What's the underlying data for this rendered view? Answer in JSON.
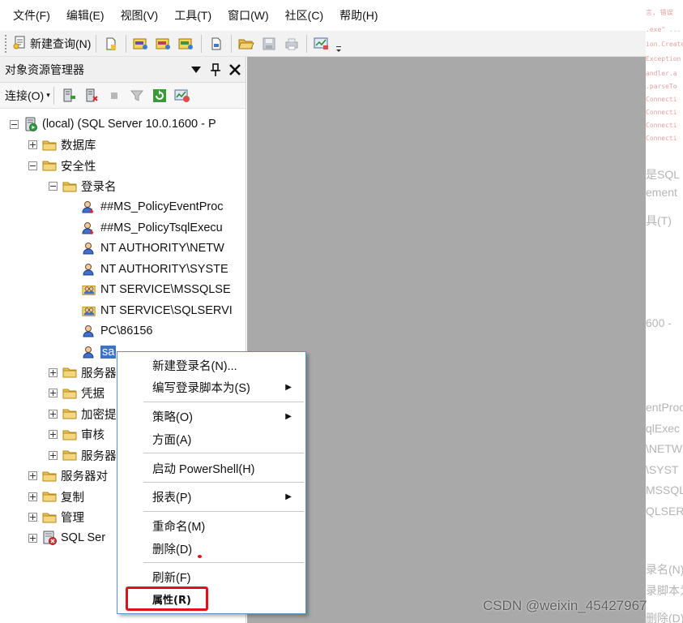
{
  "menubar": [
    "文件(F)",
    "编辑(E)",
    "视图(V)",
    "工具(T)",
    "窗口(W)",
    "社区(C)",
    "帮助(H)"
  ],
  "toolbar": {
    "new_query": "新建查询(N)"
  },
  "panel": {
    "title": "对象资源管理器",
    "pin": "ꟸ",
    "connect": "连接(O)",
    "connect_caret": "▾"
  },
  "tree": [
    {
      "label": "(local) (SQL Server 10.0.1600 - P",
      "level": 0,
      "expander": "⊟",
      "icon": "server-icon",
      "name": "tree-server-root"
    },
    {
      "label": "数据库",
      "level": 1,
      "expander": "⊞",
      "icon": "folder-icon",
      "name": "tree-databases"
    },
    {
      "label": "安全性",
      "level": 1,
      "expander": "⊟",
      "icon": "folder-icon",
      "name": "tree-security"
    },
    {
      "label": "登录名",
      "level": 2,
      "expander": "⊟",
      "icon": "folder-icon",
      "name": "tree-logins"
    },
    {
      "label": "##MS_PolicyEventProc",
      "level": 3,
      "expander": "",
      "icon": "login-disabled-icon",
      "name": "tree-login"
    },
    {
      "label": "##MS_PolicyTsqlExecu",
      "level": 3,
      "expander": "",
      "icon": "login-disabled-icon",
      "name": "tree-login"
    },
    {
      "label": "NT AUTHORITY\\NETW",
      "level": 3,
      "expander": "",
      "icon": "login-icon",
      "name": "tree-login"
    },
    {
      "label": "NT AUTHORITY\\SYSTE",
      "level": 3,
      "expander": "",
      "icon": "login-icon",
      "name": "tree-login"
    },
    {
      "label": "NT SERVICE\\MSSQLSE",
      "level": 3,
      "expander": "",
      "icon": "group-login-icon",
      "name": "tree-login"
    },
    {
      "label": "NT SERVICE\\SQLSERVI",
      "level": 3,
      "expander": "",
      "icon": "group-login-icon",
      "name": "tree-login"
    },
    {
      "label": "PC\\86156",
      "level": 3,
      "expander": "",
      "icon": "login-icon",
      "name": "tree-login"
    },
    {
      "label": "sa",
      "level": 3,
      "expander": "",
      "icon": "login-icon",
      "name": "tree-login-sa",
      "selected": true
    },
    {
      "label": "服务器",
      "level": 2,
      "expander": "⊞",
      "icon": "folder-icon",
      "name": "tree-folder"
    },
    {
      "label": "凭据",
      "level": 2,
      "expander": "⊞",
      "icon": "folder-icon",
      "name": "tree-folder"
    },
    {
      "label": "加密提",
      "level": 2,
      "expander": "⊞",
      "icon": "folder-icon",
      "name": "tree-folder"
    },
    {
      "label": "审核",
      "level": 2,
      "expander": "⊞",
      "icon": "folder-icon",
      "name": "tree-folder"
    },
    {
      "label": "服务器",
      "level": 2,
      "expander": "⊞",
      "icon": "folder-icon",
      "name": "tree-folder"
    },
    {
      "label": "服务器对",
      "level": 1,
      "expander": "⊞",
      "icon": "folder-icon",
      "name": "tree-folder"
    },
    {
      "label": "复制",
      "level": 1,
      "expander": "⊞",
      "icon": "folder-icon",
      "name": "tree-folder"
    },
    {
      "label": "管理",
      "level": 1,
      "expander": "⊞",
      "icon": "folder-icon",
      "name": "tree-folder"
    },
    {
      "label": "SQL Ser",
      "level": 1,
      "expander": "⊞",
      "icon": "agent-icon",
      "name": "tree-sql-agent"
    }
  ],
  "context_menu": {
    "items": [
      {
        "label": "新建登录名(N)...",
        "submenu": false,
        "name": "menu-new-login"
      },
      {
        "label": "编写登录脚本为(S)",
        "submenu": true,
        "name": "menu-script-login"
      },
      {
        "label": "策略(O)",
        "submenu": true,
        "name": "menu-policies"
      },
      {
        "label": "方面(A)",
        "submenu": false,
        "name": "menu-facets"
      },
      {
        "label": "启动 PowerShell(H)",
        "submenu": false,
        "name": "menu-start-powershell"
      },
      {
        "label": "报表(P)",
        "submenu": true,
        "name": "menu-reports"
      },
      {
        "label": "重命名(M)",
        "submenu": false,
        "name": "menu-rename"
      },
      {
        "label": "删除(D)",
        "submenu": false,
        "name": "menu-delete"
      },
      {
        "label": "刷新(F)",
        "submenu": false,
        "name": "menu-refresh"
      },
      {
        "label": "属性(R)",
        "submenu": false,
        "name": "menu-properties"
      }
    ],
    "submenu_arrow": "▶"
  },
  "background_window": {
    "small_lines": [
      "言, 错误",
      ".exe\" ...",
      "ion.Create",
      "Exception",
      "andler.a",
      ".parseTo",
      "Connecti",
      "Connecti",
      "Connecti",
      "Connecti"
    ],
    "text_lines": [
      "是SQL S",
      "ement",
      "具(T)",
      "600 -",
      "entProc",
      "qlExec",
      "\\NETW",
      "\\SYST",
      "MSSQLS",
      "QLSERV",
      "录名(N)",
      "录脚本为",
      "删除(D)"
    ]
  },
  "watermark": "CSDN @weixin_45427967",
  "colors": {
    "selection": "#3b74c6",
    "highlight": "#e3101a",
    "content_gray": "#a9a9a9"
  }
}
